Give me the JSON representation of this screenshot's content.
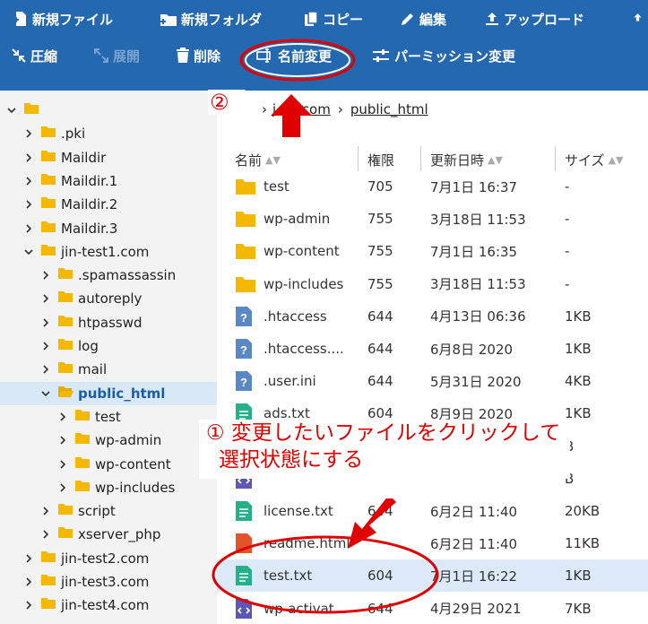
{
  "toolbar": {
    "row1": [
      {
        "id": "new-file",
        "label": "新規ファイル",
        "icon": "file-plus-icon"
      },
      {
        "id": "new-folder",
        "label": "新規フォルダ",
        "icon": "folder-plus-icon"
      },
      {
        "id": "copy",
        "label": "コピー",
        "icon": "copy-icon"
      },
      {
        "id": "edit",
        "label": "編集",
        "icon": "pencil-icon"
      },
      {
        "id": "upload",
        "label": "アップロード",
        "icon": "upload-icon"
      }
    ],
    "row2": [
      {
        "id": "compress",
        "label": "圧縮",
        "icon": "compress-icon",
        "disabled": false
      },
      {
        "id": "extract",
        "label": "展開",
        "icon": "expand-icon",
        "disabled": true
      },
      {
        "id": "delete",
        "label": "削除",
        "icon": "trash-icon",
        "disabled": false
      },
      {
        "id": "rename",
        "label": "名前変更",
        "icon": "rename-icon",
        "disabled": false
      },
      {
        "id": "permission",
        "label": "パーミッション変更",
        "icon": "sliders-icon",
        "disabled": false
      }
    ]
  },
  "colors": {
    "toolbar_bg": "#2468b0",
    "annotation_red": "#e00000",
    "folder_yellow": "#f5b800",
    "selection_bg": "#d9e8f7"
  },
  "tree": [
    {
      "label": "",
      "depth": 0,
      "expanded": true
    },
    {
      "label": ".pki",
      "depth": 1
    },
    {
      "label": "Maildir",
      "depth": 1
    },
    {
      "label": "Maildir.1",
      "depth": 1
    },
    {
      "label": "Maildir.2",
      "depth": 1
    },
    {
      "label": "Maildir.3",
      "depth": 1
    },
    {
      "label": "jin-test1.com",
      "depth": 1,
      "expanded": true
    },
    {
      "label": ".spamassassin",
      "depth": 2
    },
    {
      "label": "autoreply",
      "depth": 2
    },
    {
      "label": "htpasswd",
      "depth": 2
    },
    {
      "label": "log",
      "depth": 2
    },
    {
      "label": "mail",
      "depth": 2
    },
    {
      "label": "public_html",
      "depth": 2,
      "expanded": true,
      "selected": true
    },
    {
      "label": "test",
      "depth": 3
    },
    {
      "label": "wp-admin",
      "depth": 3
    },
    {
      "label": "wp-content",
      "depth": 3
    },
    {
      "label": "wp-includes",
      "depth": 3
    },
    {
      "label": "script",
      "depth": 2
    },
    {
      "label": "xserver_php",
      "depth": 2
    },
    {
      "label": "jin-test2.com",
      "depth": 1
    },
    {
      "label": "jin-test3.com",
      "depth": 1
    },
    {
      "label": "jin-test4.com",
      "depth": 1
    }
  ],
  "breadcrumb": {
    "domain": "j...1.com",
    "folder": "public_html"
  },
  "columns": {
    "name": "名前",
    "perm": "権限",
    "date": "更新日時",
    "size": "サイズ"
  },
  "files": [
    {
      "name": "test",
      "perm": "705",
      "date": "7月1日 16:37",
      "size": "-",
      "type": "folder"
    },
    {
      "name": "wp-admin",
      "perm": "755",
      "date": "3月18日 11:53",
      "size": "-",
      "type": "folder"
    },
    {
      "name": "wp-content",
      "perm": "755",
      "date": "7月1日 16:35",
      "size": "-",
      "type": "folder"
    },
    {
      "name": "wp-includes",
      "perm": "755",
      "date": "3月18日 11:53",
      "size": "-",
      "type": "folder"
    },
    {
      "name": ".htaccess",
      "perm": "644",
      "date": "4月13日 06:36",
      "size": "1KB",
      "type": "unknown"
    },
    {
      "name": ".htaccess....",
      "perm": "644",
      "date": "6月8日 2020",
      "size": "1KB",
      "type": "unknown"
    },
    {
      "name": ".user.ini",
      "perm": "644",
      "date": "5月31日 2020",
      "size": "4KB",
      "type": "unknown"
    },
    {
      "name": "ads.txt",
      "perm": "604",
      "date": "8月9日 2020",
      "size": "1KB",
      "type": "text"
    },
    {
      "name": "",
      "perm": "",
      "date": "",
      "size": "B",
      "type": "hidden"
    },
    {
      "name": "",
      "perm": "",
      "date": "",
      "size": "B",
      "type": "code"
    },
    {
      "name": "license.txt",
      "perm": "644",
      "date": "6月2日 11:40",
      "size": "20KB",
      "type": "text"
    },
    {
      "name": "readme.html",
      "perm": "",
      "date": "6月2日 11:40",
      "size": "11KB",
      "type": "html"
    },
    {
      "name": "test.txt",
      "perm": "604",
      "date": "7月1日 16:22",
      "size": "1KB",
      "type": "text",
      "selected": true
    },
    {
      "name": "wp-activat...",
      "perm": "644",
      "date": "4月29日 2021",
      "size": "7KB",
      "type": "code"
    }
  ],
  "annotations": {
    "step1": "① 変更したいファイルをクリックして",
    "step1_line2": "選択状態にする",
    "step2": "②"
  }
}
